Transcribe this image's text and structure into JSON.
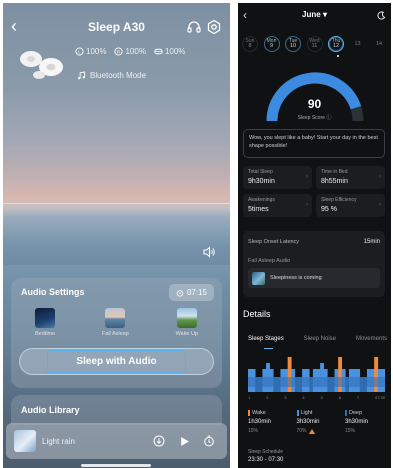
{
  "left_screen": {
    "header": {
      "title": "Sleep A30"
    },
    "battery": {
      "left": "100%",
      "right": "100%",
      "case": "100%"
    },
    "bluetooth_mode": "Bluetooth Mode",
    "audio_settings": {
      "title": "Audio Settings",
      "timer": "07:15",
      "scenes": [
        {
          "label": "Bedtime"
        },
        {
          "label": "Fall Asleep"
        },
        {
          "label": "Wake Up"
        }
      ],
      "sleep_button": "Sleep with Audio"
    },
    "audio_library": {
      "title": "Audio Library"
    },
    "player": {
      "track": "Light rain"
    }
  },
  "right_screen": {
    "month": "June",
    "days": [
      {
        "weekday": "Sun",
        "date": "8"
      },
      {
        "weekday": "Mon",
        "date": "9"
      },
      {
        "weekday": "Tue",
        "date": "10"
      },
      {
        "weekday": "Wed",
        "date": "11"
      },
      {
        "weekday": "Thu",
        "date": "12"
      },
      {
        "weekday": "",
        "date": "13"
      },
      {
        "weekday": "",
        "date": "14"
      }
    ],
    "sleep_score": {
      "value": "90",
      "label": "Sleep Score",
      "fraction": 0.9
    },
    "message": "Wow, you slept like a baby! Start your day in the best shape possible!",
    "stats": [
      {
        "label": "Total Sleep",
        "value": "9h30min"
      },
      {
        "label": "Time in Bed",
        "value": "8h55min"
      },
      {
        "label": "Awakenings",
        "value": "5times"
      },
      {
        "label": "Sleep Efficiency",
        "value": "95 %"
      }
    ],
    "latency": {
      "label": "Sleep Onset Latency",
      "value": "15min",
      "fall_asleep_label": "Fall Asleep Audio",
      "fall_asleep_item": "Sleepiness is coming"
    },
    "details": {
      "title": "Details",
      "tabs": [
        "Sleep Stages",
        "Sleep Noise",
        "Movements"
      ],
      "axis": [
        "1",
        "2",
        "3",
        "4",
        "5",
        "6",
        "7",
        "07:30"
      ],
      "legend": [
        {
          "name": "Wake",
          "time": "1h30min",
          "pct": "15%",
          "color": "#f08a3c",
          "warn": false
        },
        {
          "name": "Light",
          "time": "3h30min",
          "pct": "70%",
          "color": "#4a92e0",
          "warn": true
        },
        {
          "name": "Deep",
          "time": "3h30min",
          "pct": "15%",
          "color": "#2f6db2",
          "warn": false
        }
      ],
      "schedule_label": "Sleep Schedule",
      "schedule_value": "23:30 - 07:30"
    }
  },
  "colors": {
    "accent_blue": "#5eb1ef",
    "wake_orange": "#f08a3c",
    "light_blue": "#4a92e0",
    "deep_blue": "#2f6db2"
  }
}
